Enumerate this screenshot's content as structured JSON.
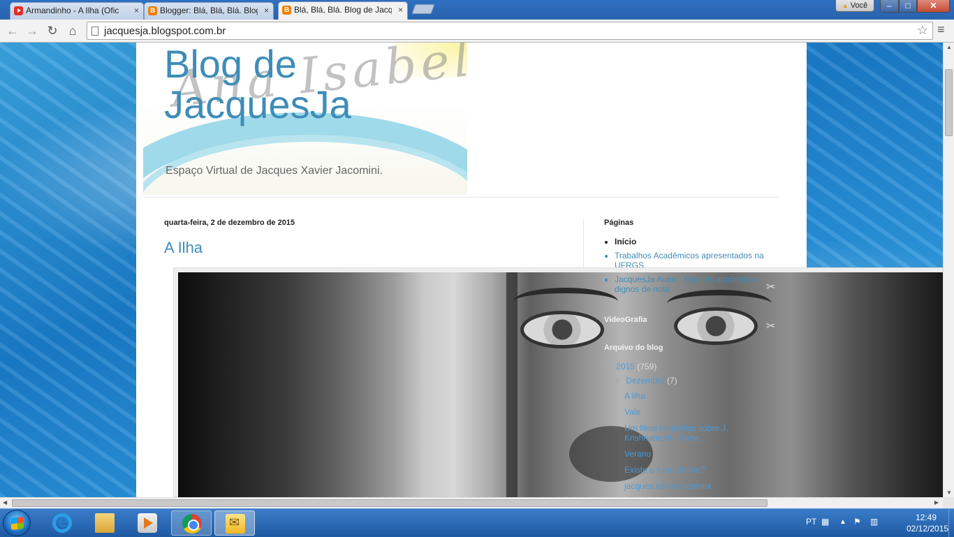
{
  "browser": {
    "tabs": [
      {
        "title": "Armandinho - A Ilha (Ofic",
        "favicon": "youtube-icon",
        "active": false
      },
      {
        "title": "Blogger: Blá, Blá, Blá. Blog",
        "favicon": "blogger-icon",
        "active": false
      },
      {
        "title": "Blá, Blá, Blá. Blog de Jacqu",
        "favicon": "blogger-icon",
        "active": true
      }
    ],
    "tab_close_glyph": "×",
    "user_button_label": "Você",
    "url": "jacquesja.blogspot.com.br",
    "window_buttons": {
      "minimize": "–",
      "maximize": "□",
      "close": "✕"
    }
  },
  "blog": {
    "title": "Blog de JacquesJa",
    "title_line1": "Blog de",
    "title_line2": "JacquesJa",
    "header_scribble": "Ana Isabel",
    "description": "Espaço Virtual de Jacques Xavier Jacomini.",
    "post_date": "quarta-feira, 2 de dezembro de 2015",
    "post_title": "A Ilha"
  },
  "sidebar": {
    "pages_title": "Páginas",
    "pages": [
      {
        "label": "Início",
        "current": true
      },
      {
        "label": "Trabalhos Acadêmicos apresentados na UFRGS",
        "current": false
      },
      {
        "label": "JacquesJa Autor - Escritos acadêmicos dignos de nota",
        "current": false
      }
    ],
    "videografia_title": "VideoGrafia",
    "archive_title": "Arquivo do blog",
    "archive_year": "2015",
    "archive_year_count": "(759)",
    "archive_month": "Dezembro",
    "archive_month_count": "(7)",
    "archive_posts": [
      "A Ilha",
      "Vale",
      "Um filme biográfico sobre J. Krishnamurti - Parte ...",
      "Verano",
      "Existe o livre arbítrio?",
      "jacques xavier jacomini"
    ],
    "toggle_glyph": "▼"
  },
  "taskbar": {
    "apps": [
      "internet-explorer-icon",
      "file-explorer-icon",
      "media-player-icon",
      "chrome-icon",
      "outlook-icon"
    ],
    "language": "PT",
    "time": "12:49",
    "date": "02/12/2015"
  },
  "colors": {
    "link": "#3e8db8",
    "taskbar": "#2a68b3",
    "tab_bar": "#2f6fc1"
  }
}
